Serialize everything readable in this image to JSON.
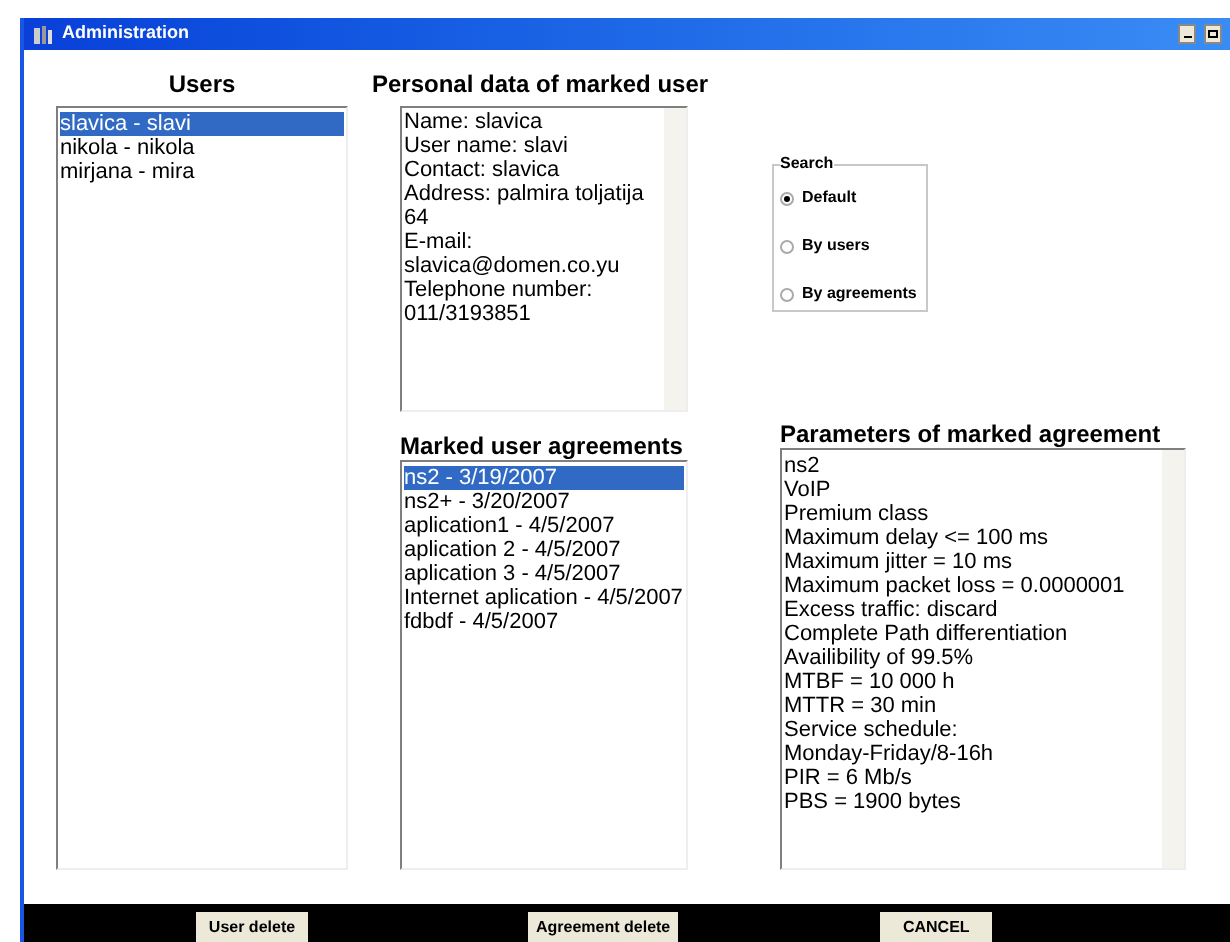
{
  "window": {
    "title": "Administration"
  },
  "users": {
    "heading": "Users",
    "items": [
      {
        "label": "slavica - slavi",
        "selected": true
      },
      {
        "label": "nikola - nikola",
        "selected": false
      },
      {
        "label": "mirjana - mira",
        "selected": false
      }
    ]
  },
  "personal_data": {
    "heading": "Personal data of marked user",
    "lines": [
      "Name: slavica",
      "User name: slavi",
      "Contact: slavica",
      "Address: palmira toljatija",
      "64",
      "E-mail:",
      "slavica@domen.co.yu",
      "Telephone number:",
      "011/3193851"
    ]
  },
  "search": {
    "title": "Search",
    "options": [
      {
        "label": "Default",
        "selected": true
      },
      {
        "label": "By users",
        "selected": false
      },
      {
        "label": "By agreements",
        "selected": false
      }
    ]
  },
  "agreements": {
    "heading": "Marked user agreements",
    "items": [
      {
        "label": "ns2 - 3/19/2007",
        "selected": true
      },
      {
        "label": "ns2+ - 3/20/2007",
        "selected": false
      },
      {
        "label": "aplication1 - 4/5/2007",
        "selected": false
      },
      {
        "label": "aplication 2 - 4/5/2007",
        "selected": false
      },
      {
        "label": "aplication 3 - 4/5/2007",
        "selected": false
      },
      {
        "label": "Internet aplication - 4/5/2007",
        "selected": false
      },
      {
        "label": "fdbdf - 4/5/2007",
        "selected": false
      }
    ]
  },
  "parameters": {
    "heading": "Parameters of marked agreement",
    "lines": [
      "ns2",
      "VoIP",
      "Premium class",
      "Maximum delay <= 100 ms",
      "Maximum jitter = 10 ms",
      "Maximum packet loss = 0.0000001",
      "Excess traffic: discard",
      "Complete Path differentiation",
      "Availibility of 99.5%",
      "MTBF = 10 000 h",
      "MTTR = 30 min",
      "Service schedule:",
      "Monday-Friday/8-16h",
      "PIR = 6 Mb/s",
      "PBS = 1900 bytes"
    ]
  },
  "buttons": [
    "User delete",
    "Agreement delete",
    "CANCEL"
  ]
}
